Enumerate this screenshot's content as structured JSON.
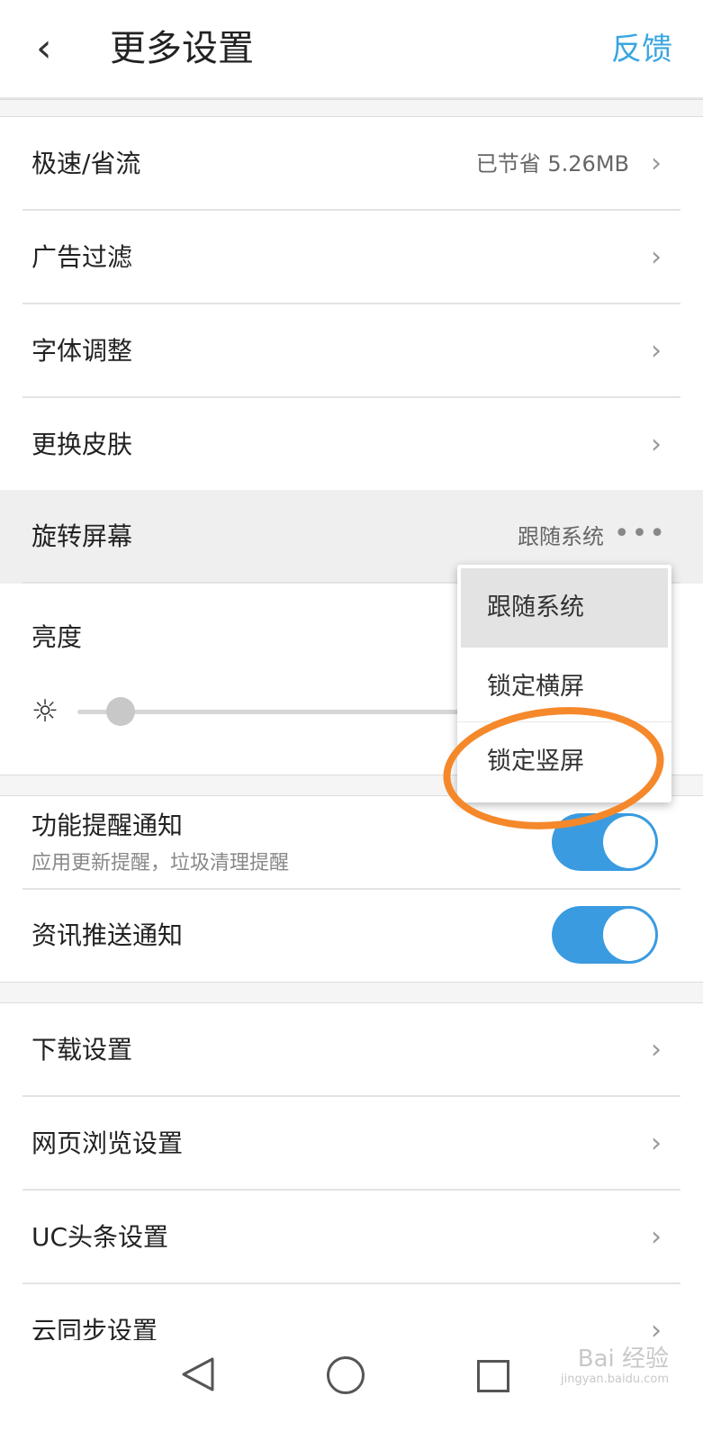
{
  "header": {
    "back_icon": "chevron-left-icon",
    "back_glyph": "‹",
    "title": "更多设置",
    "feedback": "反馈"
  },
  "settings_group1": [
    {
      "label": "极速/省流",
      "value": "已节省 5.26MB",
      "chevron": "›"
    },
    {
      "label": "广告过滤",
      "value": "",
      "chevron": "›"
    },
    {
      "label": "字体调整",
      "value": "",
      "chevron": "›"
    },
    {
      "label": "更换皮肤",
      "value": "",
      "chevron": "›"
    },
    {
      "label": "旋转屏幕",
      "value": "跟随系统",
      "more": "•••"
    }
  ],
  "brightness": {
    "label": "亮度",
    "icon": "sun-icon",
    "glyph": "☼",
    "level": 0.08
  },
  "notifications": [
    {
      "title": "功能提醒通知",
      "subtitle": "应用更新提醒，垃圾清理提醒",
      "on": true
    },
    {
      "title": "资讯推送通知",
      "subtitle": "",
      "on": true
    }
  ],
  "settings_group2": [
    {
      "label": "下载设置",
      "chevron": "›"
    },
    {
      "label": "网页浏览设置",
      "chevron": "›"
    },
    {
      "label": "UC头条设置",
      "chevron": "›"
    },
    {
      "label": "云同步设置",
      "chevron": "›"
    }
  ],
  "rotate_menu": {
    "options": [
      "跟随系统",
      "锁定横屏",
      "锁定竖屏"
    ],
    "selected": "跟随系统",
    "highlight_color": "#f5882a"
  },
  "navbar": {
    "icons": [
      "back-triangle-icon",
      "home-circle-icon",
      "recents-square-icon"
    ]
  },
  "watermark": {
    "text": "Bai 经验",
    "sub": "jingyan.baidu.com"
  },
  "colors": {
    "accent": "#3aa6e0",
    "toggle_on": "#3a9be0",
    "annotation": "#f5882a"
  }
}
